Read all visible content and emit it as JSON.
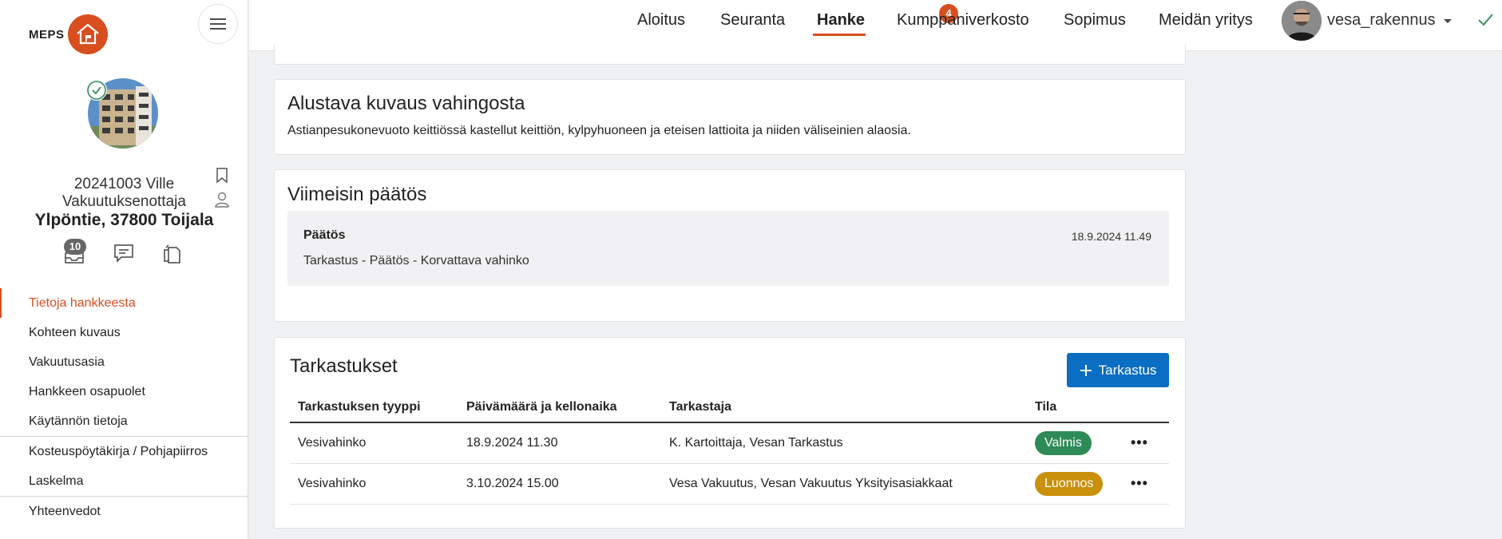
{
  "logo": {
    "text": "MEPS"
  },
  "project": {
    "id_line": "20241003 Ville",
    "owner_line": "Vakuutuksenottaja",
    "address": "Ylpöntie, 37800 Toijala",
    "doc_count": "10"
  },
  "sidebar": {
    "items": [
      {
        "label": "Tietoja hankkeesta"
      },
      {
        "label": "Kohteen kuvaus"
      },
      {
        "label": "Vakuutusasia"
      },
      {
        "label": "Hankkeen osapuolet"
      },
      {
        "label": "Käytännön tietoja"
      },
      {
        "label": "Kosteuspöytäkirja / Pohjapiirros"
      },
      {
        "label": "Laskelma"
      },
      {
        "label": "Yhteenvedot"
      }
    ]
  },
  "topnav": {
    "items": [
      {
        "label": "Aloitus"
      },
      {
        "label": "Seuranta"
      },
      {
        "label": "Hanke"
      },
      {
        "label": "Kumppaniverkosto"
      },
      {
        "label": "Sopimus"
      },
      {
        "label": "Meidän yritys"
      }
    ],
    "notification_count": "4",
    "user": "vesa_rakennus"
  },
  "description": {
    "title": "Alustava kuvaus vahingosta",
    "text": "Astianpesukonevuoto keittiössä kastellut keittiön, kylpyhuoneen ja eteisen lattioita ja niiden väliseinien alaosia."
  },
  "decision": {
    "title": "Viimeisin päätös",
    "label": "Päätös",
    "date": "18.9.2024 11.49",
    "text": "Tarkastus - Päätös - Korvattava vahinko"
  },
  "inspections": {
    "title": "Tarkastukset",
    "add_label": "Tarkastus",
    "columns": [
      "Tarkastuksen tyyppi",
      "Päivämäärä ja kellonaika",
      "Tarkastaja",
      "Tila"
    ],
    "rows": [
      {
        "type": "Vesivahinko",
        "date": "18.9.2024 11.30",
        "inspector": "K. Kartoittaja, Vesan Tarkastus",
        "status": "Valmis",
        "status_color": "#2e8b57"
      },
      {
        "type": "Vesivahinko",
        "date": "3.10.2024 15.00",
        "inspector": "Vesa Vakuutus, Vesan Vakuutus Yksityisasiakkaat",
        "status": "Luonnos",
        "status_color": "#c9900b"
      }
    ]
  },
  "colors": {
    "accent": "#d94e1f",
    "primary": "#0a6ec2"
  }
}
